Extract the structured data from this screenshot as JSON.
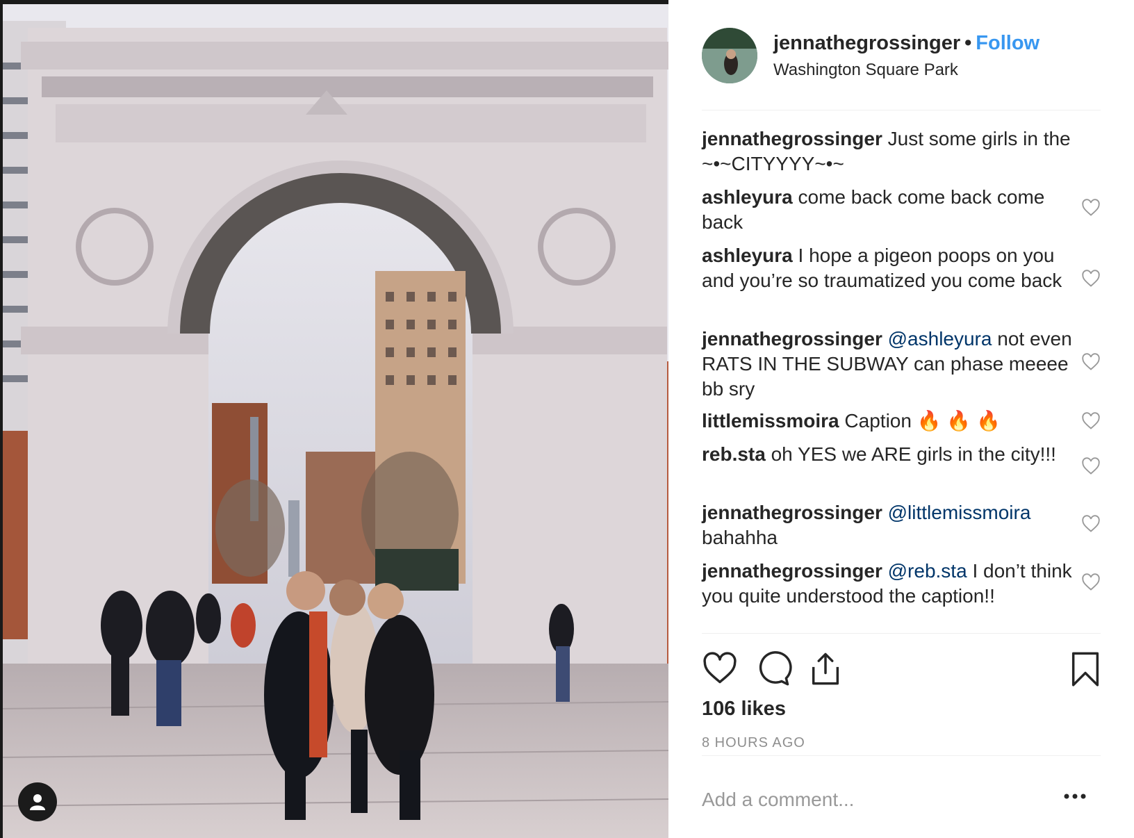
{
  "post": {
    "username": "jennathegrossinger",
    "separator": "•",
    "follow_label": "Follow",
    "location": "Washington Square Park"
  },
  "caption": {
    "user": "jennathegrossinger",
    "text": "Just some girls in the ~•~CITYYYY~•~"
  },
  "comments": [
    {
      "user": "ashleyura",
      "mention": "",
      "text": "come back come back come back"
    },
    {
      "user": "ashleyura",
      "mention": "",
      "text": "I hope a pigeon poops on you and you’re so traumatized you come back"
    },
    {
      "user": "jennathegrossinger",
      "mention": "@ashleyura",
      "text": "not even RATS IN THE SUBWAY can phase meeee bb sry"
    },
    {
      "user": "littlemissmoira",
      "mention": "",
      "text": "Caption 🔥 🔥 🔥"
    },
    {
      "user": "reb.sta",
      "mention": "",
      "text": "oh YES we ARE girls in the city!!!"
    },
    {
      "user": "jennathegrossinger",
      "mention": "@littlemissmoira",
      "text": "bahahha"
    },
    {
      "user": "jennathegrossinger",
      "mention": "@reb.sta",
      "text": "I don’t think you quite understood the caption!!"
    }
  ],
  "stats": {
    "likes": "106 likes",
    "time_ago": "8 HOURS AGO"
  },
  "add_comment": {
    "placeholder": "Add a comment..."
  },
  "icons": {
    "like": "heart-icon",
    "comment": "comment-bubble-icon",
    "share": "share-upload-icon",
    "save": "bookmark-icon",
    "more": "more-options-icon",
    "tag": "user-tag-icon",
    "comment_like": "heart-outline-icon"
  },
  "colors": {
    "follow": "#3897f0",
    "mention": "#003569",
    "muted": "#8e8e8e",
    "text": "#262626"
  }
}
